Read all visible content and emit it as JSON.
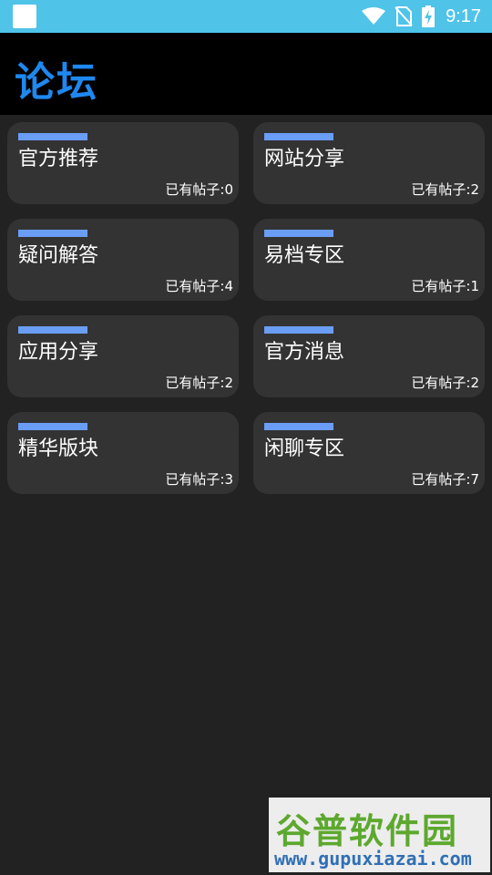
{
  "status_bar": {
    "time": "9:17",
    "icons": [
      "wifi-icon",
      "no-sim-icon",
      "battery-charging-icon"
    ]
  },
  "header": {
    "title": "论坛"
  },
  "forums": [
    {
      "name": "官方推荐",
      "count": "已有帖子:0"
    },
    {
      "name": "网站分享",
      "count": "已有帖子:2"
    },
    {
      "name": "疑问解答",
      "count": "已有帖子:4"
    },
    {
      "name": "易档专区",
      "count": "已有帖子:1"
    },
    {
      "name": "应用分享",
      "count": "已有帖子:2"
    },
    {
      "name": "官方消息",
      "count": "已有帖子:2"
    },
    {
      "name": "精华版块",
      "count": "已有帖子:3"
    },
    {
      "name": "闲聊专区",
      "count": "已有帖子:7"
    }
  ],
  "watermark": {
    "title": "谷普软件园",
    "url": "www.gupuxiazai.com"
  },
  "colors": {
    "status_bar": "#4fc3e8",
    "title_accent": "#1e88f0",
    "card_bar": "#6a9df5",
    "card_bg": "#333333",
    "page_bg": "#222222"
  }
}
